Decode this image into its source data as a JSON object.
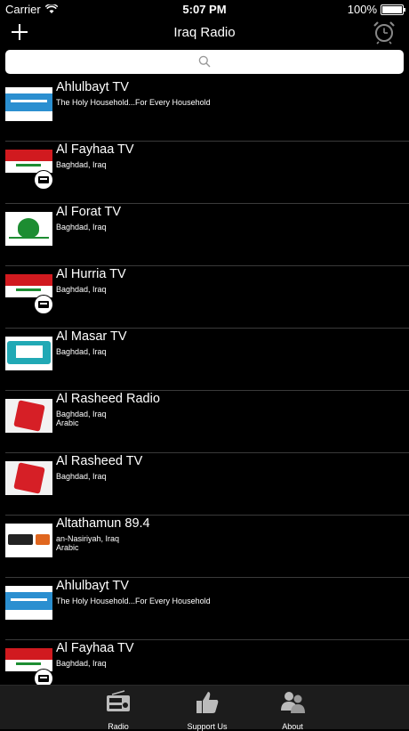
{
  "status": {
    "carrier": "Carrier",
    "time": "5:07 PM",
    "battery": "100%"
  },
  "nav": {
    "title": "Iraq Radio"
  },
  "search": {
    "placeholder": ""
  },
  "stations": [
    {
      "name": "Ahlulbayt TV",
      "line1": "The Holy Household...For Every Household",
      "line2": "",
      "logo": "ahlulbayt-logo",
      "badge": false
    },
    {
      "name": "Al Fayhaa TV",
      "line1": "Baghdad, Iraq",
      "line2": "",
      "logo": "iraq-flag",
      "badge": true
    },
    {
      "name": "Al Forat TV",
      "line1": "Baghdad, Iraq",
      "line2": "",
      "logo": "forat-logo",
      "badge": false
    },
    {
      "name": "Al Hurria TV",
      "line1": "Baghdad, Iraq",
      "line2": "",
      "logo": "iraq-flag",
      "badge": true
    },
    {
      "name": "Al Masar TV",
      "line1": "Baghdad, Iraq",
      "line2": "",
      "logo": "masar-logo",
      "badge": false
    },
    {
      "name": "Al Rasheed Radio",
      "line1": "Baghdad, Iraq",
      "line2": "Arabic",
      "logo": "rasheed-logo",
      "badge": false
    },
    {
      "name": "Al Rasheed TV",
      "line1": "Baghdad, Iraq",
      "line2": "",
      "logo": "rasheed-logo",
      "badge": false
    },
    {
      "name": "Altathamun 89.4",
      "line1": "an-Nasiriyah, Iraq",
      "line2": "Arabic",
      "logo": "altathamun-logo",
      "badge": false
    },
    {
      "name": "Ahlulbayt TV",
      "line1": "The Holy Household...For Every Household",
      "line2": "",
      "logo": "ahlulbayt-logo",
      "badge": false
    },
    {
      "name": "Al Fayhaa TV",
      "line1": "Baghdad, Iraq",
      "line2": "",
      "logo": "iraq-flag",
      "badge": true
    }
  ],
  "tabs": [
    {
      "label": "Radio",
      "icon": "radio-icon"
    },
    {
      "label": "Support Us",
      "icon": "thumbs-up-icon"
    },
    {
      "label": "About",
      "icon": "people-icon"
    }
  ]
}
